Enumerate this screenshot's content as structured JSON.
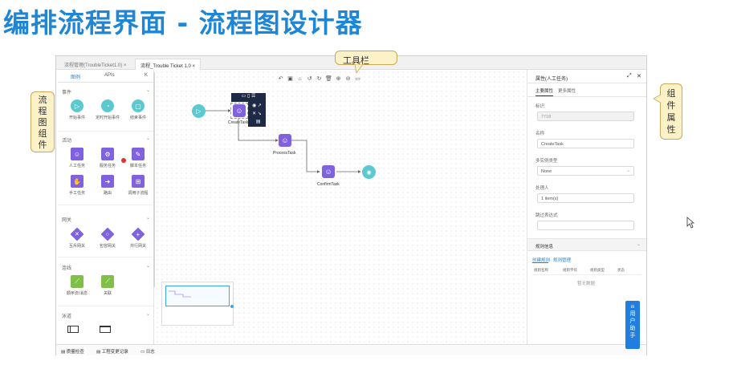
{
  "page_title": "编排流程界面 - 流程图设计器",
  "tabs": [
    {
      "label": "流程管理(TroubleTicket1.0)"
    },
    {
      "label": "流程_Trouble Ticket 1.0"
    }
  ],
  "tab_close": "×",
  "callouts": {
    "toolbar": "工具栏",
    "left": [
      "流",
      "程",
      "图",
      "组",
      "件"
    ],
    "right": [
      "组",
      "件",
      "属",
      "性"
    ]
  },
  "palette": {
    "tabs": [
      "图例",
      "APIs"
    ],
    "collapse": "K",
    "sections": [
      {
        "title": "事件",
        "items": [
          {
            "label": "开始事件",
            "icon": "play-icon"
          },
          {
            "label": "定时开始事件",
            "icon": "clock-icon"
          },
          {
            "label": "结束事件",
            "icon": "stop-icon"
          }
        ]
      },
      {
        "title": "活动",
        "items": [
          {
            "label": "人工任务",
            "icon": "user-task-icon"
          },
          {
            "label": "服务任务",
            "icon": "service-task-icon"
          },
          {
            "label": "脚本任务",
            "icon": "script-task-icon"
          },
          {
            "label": "手工任务",
            "icon": "hand-task-icon"
          },
          {
            "label": "路由",
            "icon": "route-icon"
          },
          {
            "label": "调用子流程",
            "icon": "subprocess-icon"
          }
        ]
      },
      {
        "title": "网关",
        "items": [
          {
            "label": "互斥网关",
            "icon": "exclusive-gateway-icon"
          },
          {
            "label": "包容网关",
            "icon": "inclusive-gateway-icon"
          },
          {
            "label": "并行网关",
            "icon": "parallel-gateway-icon"
          }
        ]
      },
      {
        "title": "连线",
        "items": [
          {
            "label": "顺序流/消息",
            "icon": "sequence-flow-icon"
          },
          {
            "label": "关联",
            "icon": "association-icon"
          }
        ]
      },
      {
        "title": "泳道",
        "items": []
      }
    ]
  },
  "nodes": [
    {
      "label": "",
      "type": "start"
    },
    {
      "label": "CreateTask",
      "type": "task"
    },
    {
      "label": "ProcessTask",
      "type": "task"
    },
    {
      "label": "ConfirmTask",
      "type": "task"
    },
    {
      "label": "",
      "type": "end"
    }
  ],
  "properties": {
    "title": "属性(人工任务)",
    "tabs": [
      "主要属性",
      "更多属性"
    ],
    "fields": [
      {
        "label": "标识",
        "value": "7718"
      },
      {
        "label": "名称",
        "value": "CreateTask"
      },
      {
        "label": "多实例类型",
        "value": "None"
      },
      {
        "label": "处理人",
        "value": "1 item(s)"
      },
      {
        "label": "跳过表达式",
        "value": ""
      }
    ],
    "rule_section": "规则信息",
    "rule_links": [
      "创建规则",
      "规则管理"
    ],
    "rule_columns": [
      "规则名称",
      "规则字符",
      "规则类型",
      "状态"
    ],
    "empty": "暂无数据"
  },
  "assistant": [
    "用",
    "户",
    "助",
    "手"
  ],
  "status_bar": [
    "质量检查",
    "工程变更记录",
    "日志"
  ]
}
